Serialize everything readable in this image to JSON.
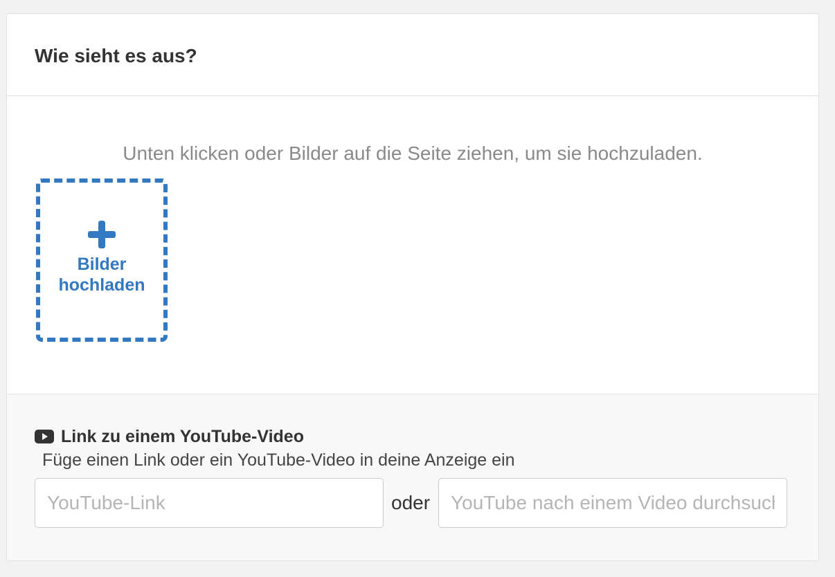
{
  "card": {
    "title": "Wie sieht es aus?"
  },
  "upload": {
    "hint": "Unten klicken oder Bilder auf die Seite ziehen, um sie hochzuladen.",
    "button_label": "Bilder hochladen",
    "icon": "plus-icon"
  },
  "video": {
    "icon": "youtube-icon",
    "title": "Link zu einem YouTube-Video",
    "description": "Füge einen Link oder ein YouTube-Video in deine Anzeige ein",
    "link_input": {
      "value": "",
      "placeholder": "YouTube-Link"
    },
    "or_label": "oder",
    "search_input": {
      "value": "",
      "placeholder": "YouTube nach einem Video durchsuchen"
    }
  },
  "colors": {
    "accent": "#3279c1",
    "background": "#f2f2f2",
    "card": "#ffffff",
    "section_bg": "#f8f8f8",
    "text": "#333333",
    "muted_text": "#8a8a8a"
  }
}
